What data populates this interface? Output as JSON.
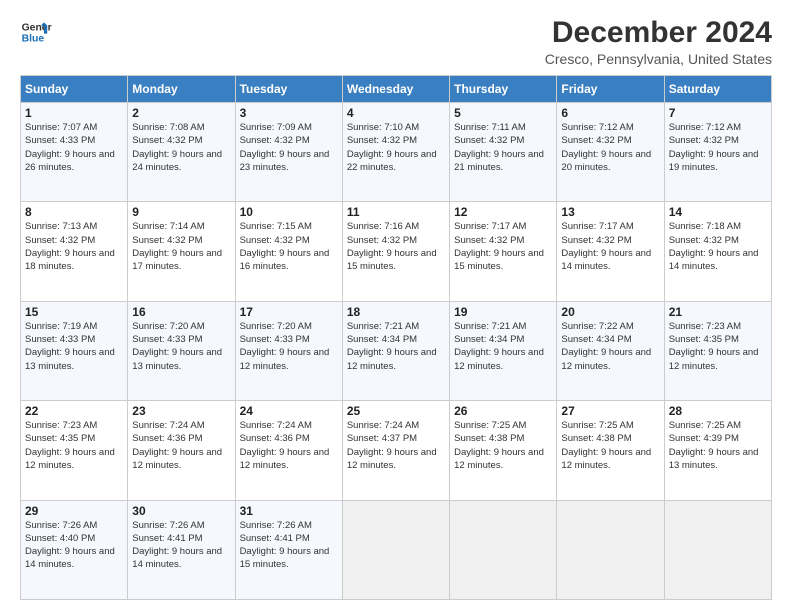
{
  "logo": {
    "line1": "General",
    "line2": "Blue"
  },
  "title": "December 2024",
  "subtitle": "Cresco, Pennsylvania, United States",
  "header_days": [
    "Sunday",
    "Monday",
    "Tuesday",
    "Wednesday",
    "Thursday",
    "Friday",
    "Saturday"
  ],
  "weeks": [
    [
      {
        "day": "1",
        "sunrise": "Sunrise: 7:07 AM",
        "sunset": "Sunset: 4:33 PM",
        "daylight": "Daylight: 9 hours and 26 minutes."
      },
      {
        "day": "2",
        "sunrise": "Sunrise: 7:08 AM",
        "sunset": "Sunset: 4:32 PM",
        "daylight": "Daylight: 9 hours and 24 minutes."
      },
      {
        "day": "3",
        "sunrise": "Sunrise: 7:09 AM",
        "sunset": "Sunset: 4:32 PM",
        "daylight": "Daylight: 9 hours and 23 minutes."
      },
      {
        "day": "4",
        "sunrise": "Sunrise: 7:10 AM",
        "sunset": "Sunset: 4:32 PM",
        "daylight": "Daylight: 9 hours and 22 minutes."
      },
      {
        "day": "5",
        "sunrise": "Sunrise: 7:11 AM",
        "sunset": "Sunset: 4:32 PM",
        "daylight": "Daylight: 9 hours and 21 minutes."
      },
      {
        "day": "6",
        "sunrise": "Sunrise: 7:12 AM",
        "sunset": "Sunset: 4:32 PM",
        "daylight": "Daylight: 9 hours and 20 minutes."
      },
      {
        "day": "7",
        "sunrise": "Sunrise: 7:12 AM",
        "sunset": "Sunset: 4:32 PM",
        "daylight": "Daylight: 9 hours and 19 minutes."
      }
    ],
    [
      {
        "day": "8",
        "sunrise": "Sunrise: 7:13 AM",
        "sunset": "Sunset: 4:32 PM",
        "daylight": "Daylight: 9 hours and 18 minutes."
      },
      {
        "day": "9",
        "sunrise": "Sunrise: 7:14 AM",
        "sunset": "Sunset: 4:32 PM",
        "daylight": "Daylight: 9 hours and 17 minutes."
      },
      {
        "day": "10",
        "sunrise": "Sunrise: 7:15 AM",
        "sunset": "Sunset: 4:32 PM",
        "daylight": "Daylight: 9 hours and 16 minutes."
      },
      {
        "day": "11",
        "sunrise": "Sunrise: 7:16 AM",
        "sunset": "Sunset: 4:32 PM",
        "daylight": "Daylight: 9 hours and 15 minutes."
      },
      {
        "day": "12",
        "sunrise": "Sunrise: 7:17 AM",
        "sunset": "Sunset: 4:32 PM",
        "daylight": "Daylight: 9 hours and 15 minutes."
      },
      {
        "day": "13",
        "sunrise": "Sunrise: 7:17 AM",
        "sunset": "Sunset: 4:32 PM",
        "daylight": "Daylight: 9 hours and 14 minutes."
      },
      {
        "day": "14",
        "sunrise": "Sunrise: 7:18 AM",
        "sunset": "Sunset: 4:32 PM",
        "daylight": "Daylight: 9 hours and 14 minutes."
      }
    ],
    [
      {
        "day": "15",
        "sunrise": "Sunrise: 7:19 AM",
        "sunset": "Sunset: 4:33 PM",
        "daylight": "Daylight: 9 hours and 13 minutes."
      },
      {
        "day": "16",
        "sunrise": "Sunrise: 7:20 AM",
        "sunset": "Sunset: 4:33 PM",
        "daylight": "Daylight: 9 hours and 13 minutes."
      },
      {
        "day": "17",
        "sunrise": "Sunrise: 7:20 AM",
        "sunset": "Sunset: 4:33 PM",
        "daylight": "Daylight: 9 hours and 12 minutes."
      },
      {
        "day": "18",
        "sunrise": "Sunrise: 7:21 AM",
        "sunset": "Sunset: 4:34 PM",
        "daylight": "Daylight: 9 hours and 12 minutes."
      },
      {
        "day": "19",
        "sunrise": "Sunrise: 7:21 AM",
        "sunset": "Sunset: 4:34 PM",
        "daylight": "Daylight: 9 hours and 12 minutes."
      },
      {
        "day": "20",
        "sunrise": "Sunrise: 7:22 AM",
        "sunset": "Sunset: 4:34 PM",
        "daylight": "Daylight: 9 hours and 12 minutes."
      },
      {
        "day": "21",
        "sunrise": "Sunrise: 7:23 AM",
        "sunset": "Sunset: 4:35 PM",
        "daylight": "Daylight: 9 hours and 12 minutes."
      }
    ],
    [
      {
        "day": "22",
        "sunrise": "Sunrise: 7:23 AM",
        "sunset": "Sunset: 4:35 PM",
        "daylight": "Daylight: 9 hours and 12 minutes."
      },
      {
        "day": "23",
        "sunrise": "Sunrise: 7:24 AM",
        "sunset": "Sunset: 4:36 PM",
        "daylight": "Daylight: 9 hours and 12 minutes."
      },
      {
        "day": "24",
        "sunrise": "Sunrise: 7:24 AM",
        "sunset": "Sunset: 4:36 PM",
        "daylight": "Daylight: 9 hours and 12 minutes."
      },
      {
        "day": "25",
        "sunrise": "Sunrise: 7:24 AM",
        "sunset": "Sunset: 4:37 PM",
        "daylight": "Daylight: 9 hours and 12 minutes."
      },
      {
        "day": "26",
        "sunrise": "Sunrise: 7:25 AM",
        "sunset": "Sunset: 4:38 PM",
        "daylight": "Daylight: 9 hours and 12 minutes."
      },
      {
        "day": "27",
        "sunrise": "Sunrise: 7:25 AM",
        "sunset": "Sunset: 4:38 PM",
        "daylight": "Daylight: 9 hours and 12 minutes."
      },
      {
        "day": "28",
        "sunrise": "Sunrise: 7:25 AM",
        "sunset": "Sunset: 4:39 PM",
        "daylight": "Daylight: 9 hours and 13 minutes."
      }
    ],
    [
      {
        "day": "29",
        "sunrise": "Sunrise: 7:26 AM",
        "sunset": "Sunset: 4:40 PM",
        "daylight": "Daylight: 9 hours and 14 minutes."
      },
      {
        "day": "30",
        "sunrise": "Sunrise: 7:26 AM",
        "sunset": "Sunset: 4:41 PM",
        "daylight": "Daylight: 9 hours and 14 minutes."
      },
      {
        "day": "31",
        "sunrise": "Sunrise: 7:26 AM",
        "sunset": "Sunset: 4:41 PM",
        "daylight": "Daylight: 9 hours and 15 minutes."
      },
      null,
      null,
      null,
      null
    ]
  ]
}
